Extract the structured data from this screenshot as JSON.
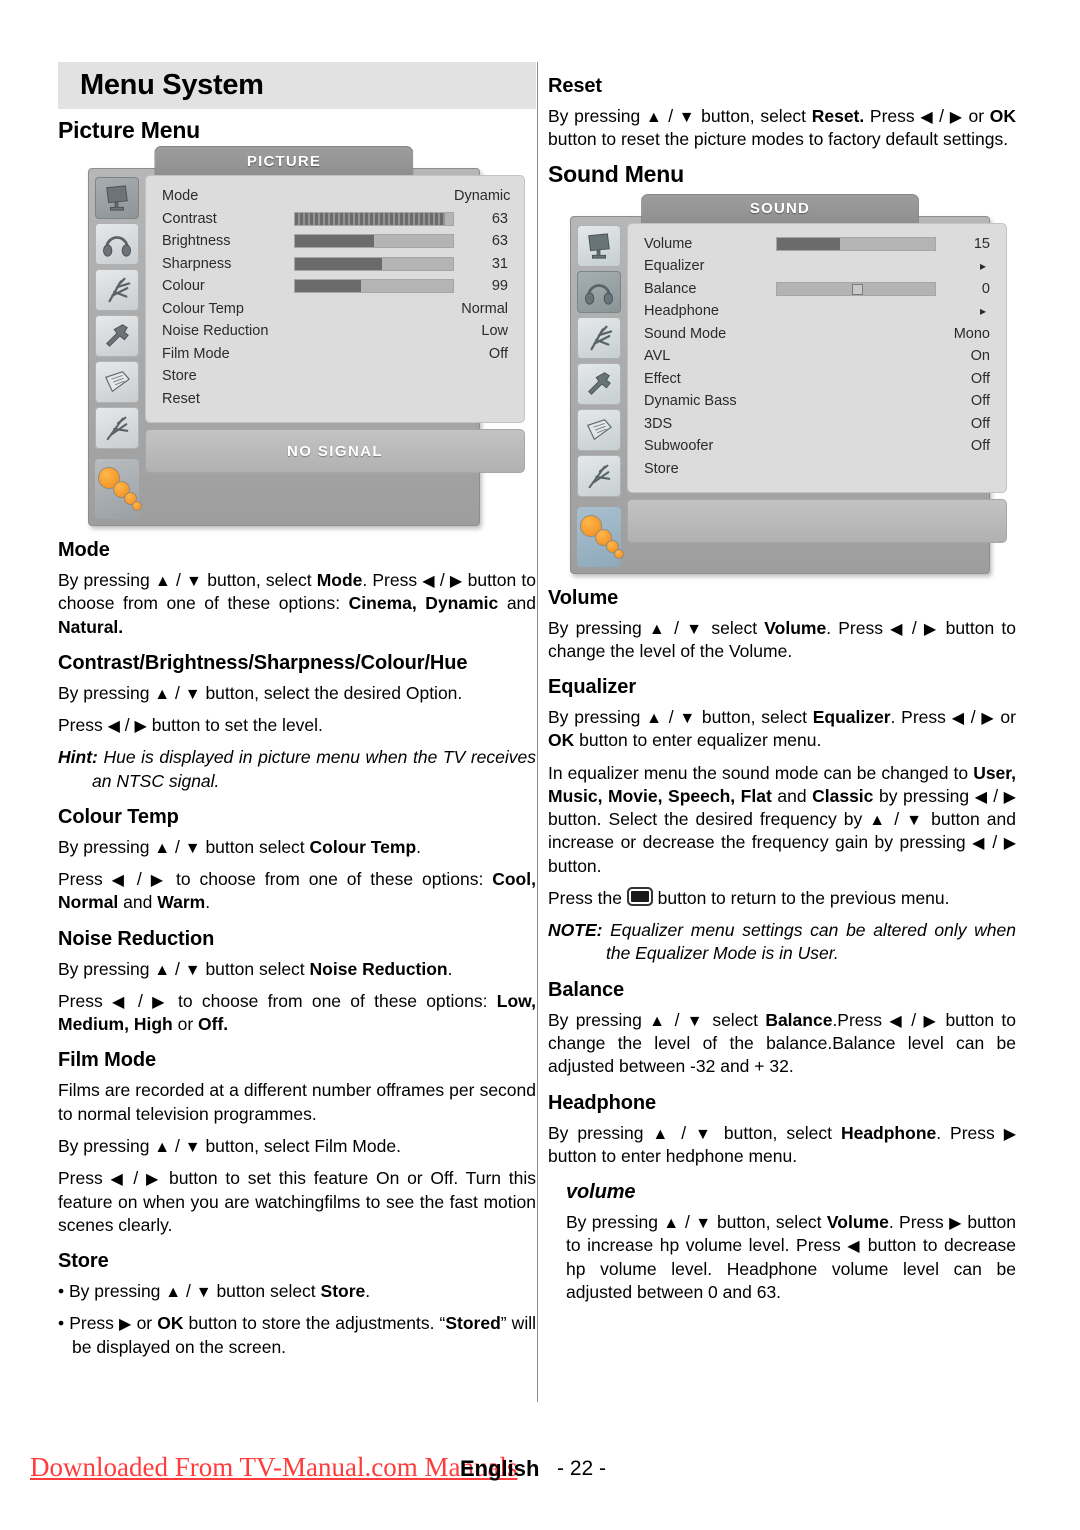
{
  "document": {
    "banner_title": "Menu System",
    "footer": {
      "watermark": "Downloaded From TV-Manual.com Manuals",
      "language": "English",
      "page": "- 22 -"
    }
  },
  "left_column": {
    "section_title": "Picture Menu",
    "osd": {
      "title": "PICTURE",
      "status": "NO SIGNAL",
      "selected_icon_index": 0,
      "icons": [
        "tv-monitor-icon",
        "headphones-icon",
        "antenna-icon",
        "wrench-icon",
        "document-icon",
        "install-icon"
      ],
      "rows": [
        {
          "label": "Mode",
          "value": "Dynamic",
          "bar": null,
          "type": "value"
        },
        {
          "label": "Contrast",
          "value": "63",
          "bar": 95,
          "type": "bar-dotted"
        },
        {
          "label": "Brightness",
          "value": "63",
          "bar": 50,
          "type": "bar"
        },
        {
          "label": "Sharpness",
          "value": "31",
          "bar": 55,
          "type": "bar"
        },
        {
          "label": "Colour",
          "value": "99",
          "bar": 42,
          "type": "bar"
        },
        {
          "label": "Colour Temp",
          "value": "Normal",
          "bar": null,
          "type": "value"
        },
        {
          "label": "Noise Reduction",
          "value": "Low",
          "bar": null,
          "type": "value"
        },
        {
          "label": "Film Mode",
          "value": "Off",
          "bar": null,
          "type": "value"
        },
        {
          "label": "Store",
          "value": "",
          "bar": null,
          "type": "action"
        },
        {
          "label": "Reset",
          "value": "",
          "bar": null,
          "type": "action"
        }
      ]
    },
    "topics": [
      {
        "heading": "Mode",
        "paragraphs": [
          "By pressing ▲ / ▼  button, select <b>Mode</b>. Press ◀ / ▶ button to choose from one of these options: <b>Cinema, Dynamic</b> and <b>Natural.</b>"
        ]
      },
      {
        "heading": "Contrast/Brightness/Sharpness/Colour/Hue",
        "paragraphs": [
          "By pressing ▲ / ▼ button, select the desired Option.",
          "Press ◀ / ▶ button to set the level.",
          "<i><b>Hint:</b> Hue is displayed in picture menu when the TV receives an NTSC signal.</i>"
        ]
      },
      {
        "heading": "Colour Temp",
        "paragraphs": [
          "By pressing ▲ / ▼ button select <b>Colour Temp</b>.",
          "Press ◀ / ▶  to choose from one of these options: <b>Cool, Normal</b> and <b>Warm</b>."
        ]
      },
      {
        "heading": "Noise Reduction",
        "paragraphs": [
          "By pressing ▲ / ▼ button select <b>Noise Reduction</b>.",
          "Press ◀ / ▶  to choose from one of these options: <b>Low, Medium, High</b> or <b>Off.</b>"
        ]
      },
      {
        "heading": "Film Mode",
        "paragraphs": [
          "Films are recorded at a different number offrames per second to normal television programmes.",
          "By pressing ▲ / ▼  button, select Film Mode.",
          "Press ◀ / ▶ button to set this feature On or Off. Turn this feature on when you are watchingfilms to see the fast motion scenes clearly."
        ]
      },
      {
        "heading": "Store",
        "paragraphs": [
          "• By pressing ▲ / ▼ button  select <b>Store</b>.",
          "• Press ▶ or <b>OK</b> button to store the adjustments. “<b>Stored</b>” will be displayed on the screen."
        ]
      }
    ]
  },
  "right_column": {
    "topics_before_sound": [
      {
        "heading": "Reset",
        "paragraphs": [
          "By pressing ▲ / ▼ button, select <b>Reset.</b> Press ◀ / ▶ or <b>OK</b> button to reset the picture modes to factory default settings."
        ]
      }
    ],
    "section_title": "Sound Menu",
    "osd": {
      "title": "SOUND",
      "status": "",
      "selected_icon_index": 1,
      "icons": [
        "tv-monitor-icon",
        "headphones-icon",
        "antenna-icon",
        "wrench-icon",
        "document-icon",
        "install-icon"
      ],
      "rows": [
        {
          "label": "Volume",
          "value": "15",
          "bar": 40,
          "type": "bar"
        },
        {
          "label": "Equalizer",
          "value": "▸",
          "bar": null,
          "type": "submenu"
        },
        {
          "label": "Balance",
          "value": "0",
          "bar": 50,
          "type": "bar-knob"
        },
        {
          "label": "Headphone",
          "value": "▸",
          "bar": null,
          "type": "submenu"
        },
        {
          "label": "Sound Mode",
          "value": "Mono",
          "bar": null,
          "type": "value"
        },
        {
          "label": "AVL",
          "value": "On",
          "bar": null,
          "type": "value"
        },
        {
          "label": "Effect",
          "value": "Off",
          "bar": null,
          "type": "value"
        },
        {
          "label": "Dynamic Bass",
          "value": "Off",
          "bar": null,
          "type": "value"
        },
        {
          "label": "3DS",
          "value": "Off",
          "bar": null,
          "type": "value"
        },
        {
          "label": "Subwoofer",
          "value": "Off",
          "bar": null,
          "type": "value"
        },
        {
          "label": "Store",
          "value": "",
          "bar": null,
          "type": "action"
        }
      ]
    },
    "topics": [
      {
        "heading": "Volume",
        "paragraphs": [
          "By pressing ▲ / ▼ select <b>Volume</b>. Press ◀ / ▶ button to change the level of the Volume."
        ]
      },
      {
        "heading": "Equalizer",
        "paragraphs": [
          "By pressing ▲ / ▼ button, select <b>Equalizer</b>. Press ◀ / ▶ or <b>OK</b> button to enter equalizer menu.",
          "In equalizer menu the sound mode can be changed to <b>User, Music, Movie, Speech, Flat</b> and <b>Classic</b> by pressing ◀ / ▶ button. Select the desired frequency by ▲ / ▼ button and increase or decrease the frequency gain by pressing ◀ / ▶ button.",
          "Press the ▣ button to return to the previous menu.",
          "<i><b>NOTE:</b> Equalizer menu settings can be altered only when the Equalizer Mode is in User.</i>"
        ]
      },
      {
        "heading": "Balance",
        "paragraphs": [
          "By pressing ▲ / ▼ select <b>Balance</b>.Press ◀ / ▶ button to change the  level of the balance.Balance level can be adjusted between -32 and + 32."
        ]
      },
      {
        "heading": "Headphone",
        "paragraphs": [
          "By pressing ▲ / ▼ button, select <b>Headphone</b>. Press ▶ button to enter hedphone menu."
        ],
        "subheading": "volume",
        "sub_paragraphs": [
          "By pressing ▲ / ▼  button, select <b>Volume</b>. Press ▶ button to increase hp volume level. Press ◀  button to decrease hp volume level. Headphone volume level can be adjusted between 0 and 63."
        ]
      }
    ]
  }
}
